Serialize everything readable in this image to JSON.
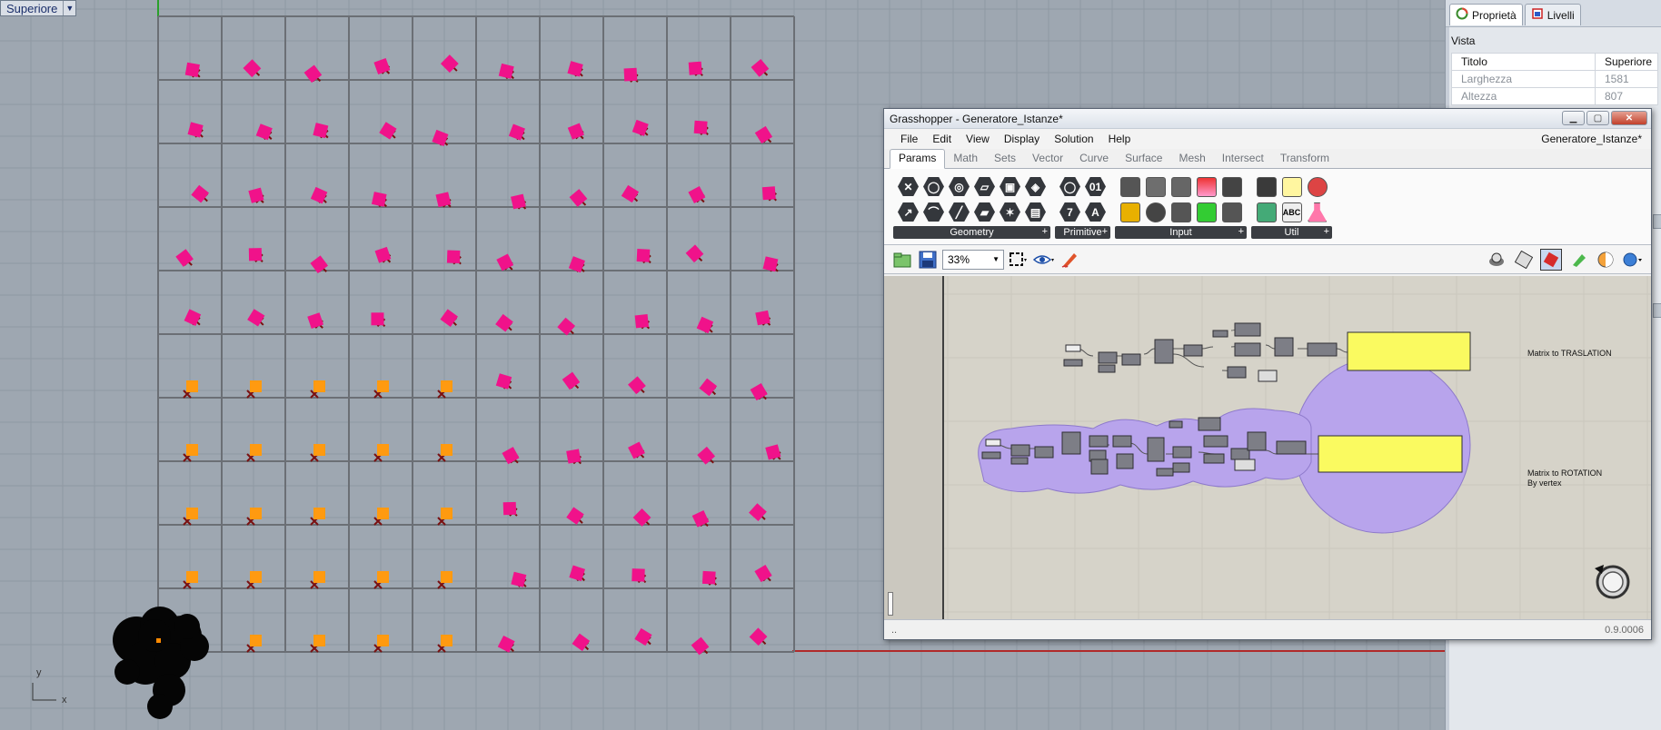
{
  "viewport": {
    "name": "Superiore",
    "axis_y": "y",
    "axis_x": "x"
  },
  "panel": {
    "tabs": [
      {
        "label": "Proprietà",
        "icon": "properties-icon"
      },
      {
        "label": "Livelli",
        "icon": "layers-icon"
      }
    ],
    "section": "Vista",
    "rows": [
      {
        "key": "Titolo",
        "value": "Superiore"
      },
      {
        "key": "Larghezza",
        "value": "1581"
      },
      {
        "key": "Altezza",
        "value": "807"
      }
    ]
  },
  "grasshopper": {
    "title": "Grasshopper - Generatore_Istanze*",
    "menu": [
      "File",
      "Edit",
      "View",
      "Display",
      "Solution",
      "Help"
    ],
    "document": "Generatore_Istanze*",
    "tabs": [
      "Params",
      "Math",
      "Sets",
      "Vector",
      "Curve",
      "Surface",
      "Mesh",
      "Intersect",
      "Transform"
    ],
    "active_tab": "Params",
    "groups": [
      "Geometry",
      "Primitive",
      "Input",
      "Util"
    ],
    "zoom": "33%",
    "labels": {
      "translation": "Matrix to TRASLATION",
      "rotation_1": "Matrix to ROTATION",
      "rotation_2": "By vertex"
    },
    "status_left": "..",
    "version": "0.9.0006"
  },
  "colors": {
    "pink_marker": "#f0128a",
    "orange_marker": "#ff9a10",
    "grid_line": "#6b6f75",
    "group_purple": "#b8a4ec",
    "panel_yellow": "#fafa60"
  }
}
